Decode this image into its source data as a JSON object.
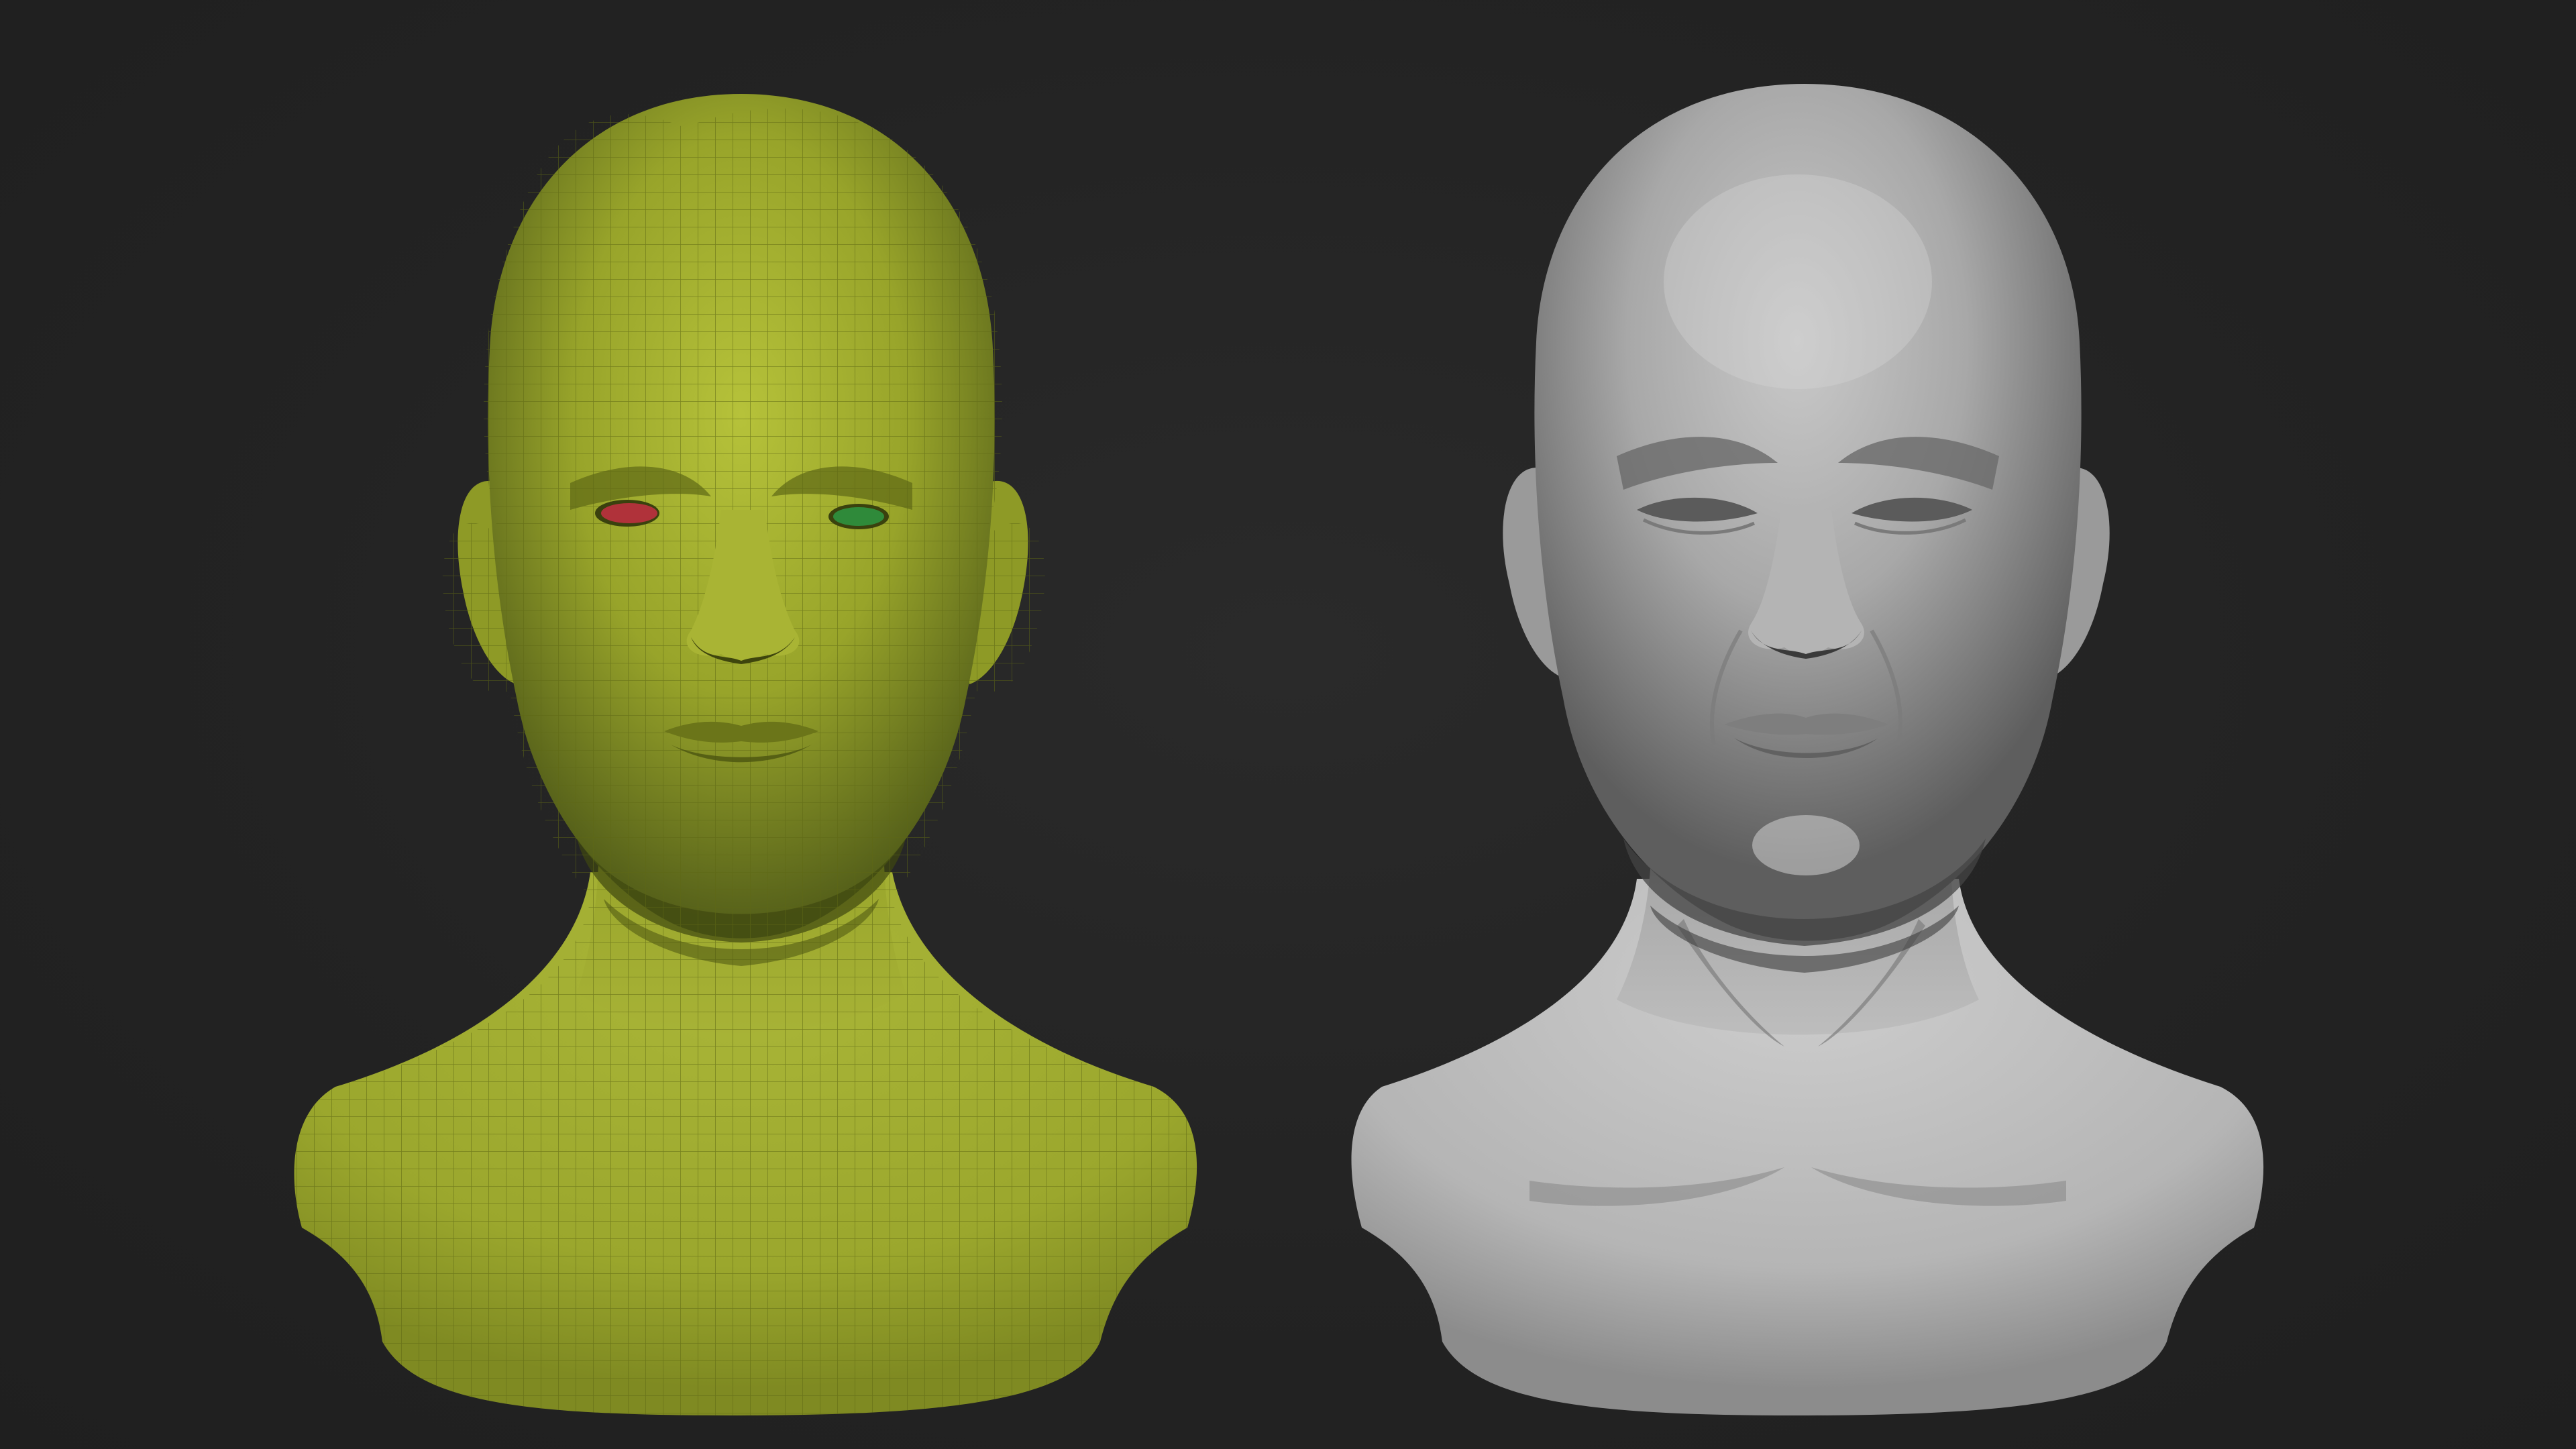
{
  "scene": {
    "background_color": "#232323",
    "left_bust": {
      "description_name": "wireframe-topology-bust",
      "material_color": "#9aa52a",
      "wire_color": "#6f7a16",
      "left_eye_color": "#b0323a",
      "right_eye_color": "#2f8a3a"
    },
    "right_bust": {
      "description_name": "sculpted-clay-bust",
      "material_color": "#b9b9b9"
    }
  }
}
